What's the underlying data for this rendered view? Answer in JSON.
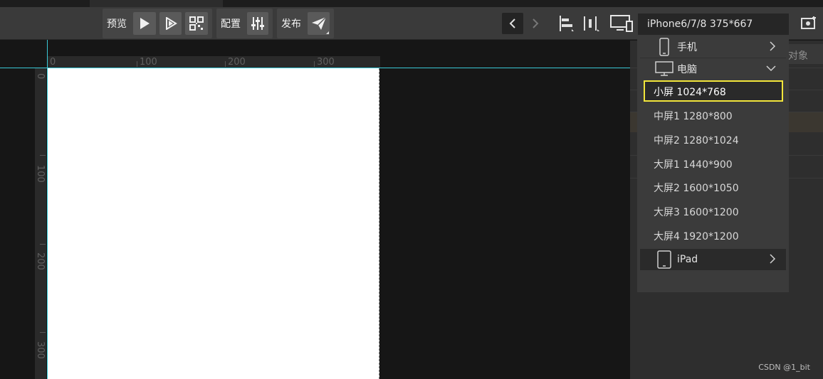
{
  "toolbar": {
    "preview_label": "预览",
    "config_label": "配置",
    "publish_label": "发布"
  },
  "device_select": {
    "current": "iPhone6/7/8 375*667"
  },
  "dropdown": {
    "categories": [
      {
        "label": "手机",
        "icon": "phone-icon",
        "state": "collapsed"
      },
      {
        "label": "电脑",
        "icon": "monitor-icon",
        "state": "expanded"
      },
      {
        "label": "iPad",
        "icon": "tablet-icon",
        "state": "collapsed"
      }
    ],
    "desktop_items": [
      {
        "label": "小屏 1024*768",
        "selected": true
      },
      {
        "label": "中屏1 1280*800",
        "selected": false
      },
      {
        "label": "中屏2 1280*1024",
        "selected": false
      },
      {
        "label": "大屏1 1440*900",
        "selected": false
      },
      {
        "label": "大屏2 1600*1050",
        "selected": false
      },
      {
        "label": "大屏3 1600*1200",
        "selected": false
      },
      {
        "label": "大屏4 1920*1200",
        "selected": false
      }
    ]
  },
  "ruler": {
    "top_ticks": [
      "0",
      "100",
      "200",
      "300"
    ],
    "left_ticks": [
      "0",
      "100",
      "200",
      "300"
    ]
  },
  "right_panel": {
    "tab_label": "对象"
  },
  "watermark": "CSDN @1_bit",
  "colors": {
    "guide": "#39c8d6",
    "selection_outline": "#f2e63b",
    "toolbar_bg": "#3a3a3a",
    "canvas_bg": "#161616"
  }
}
